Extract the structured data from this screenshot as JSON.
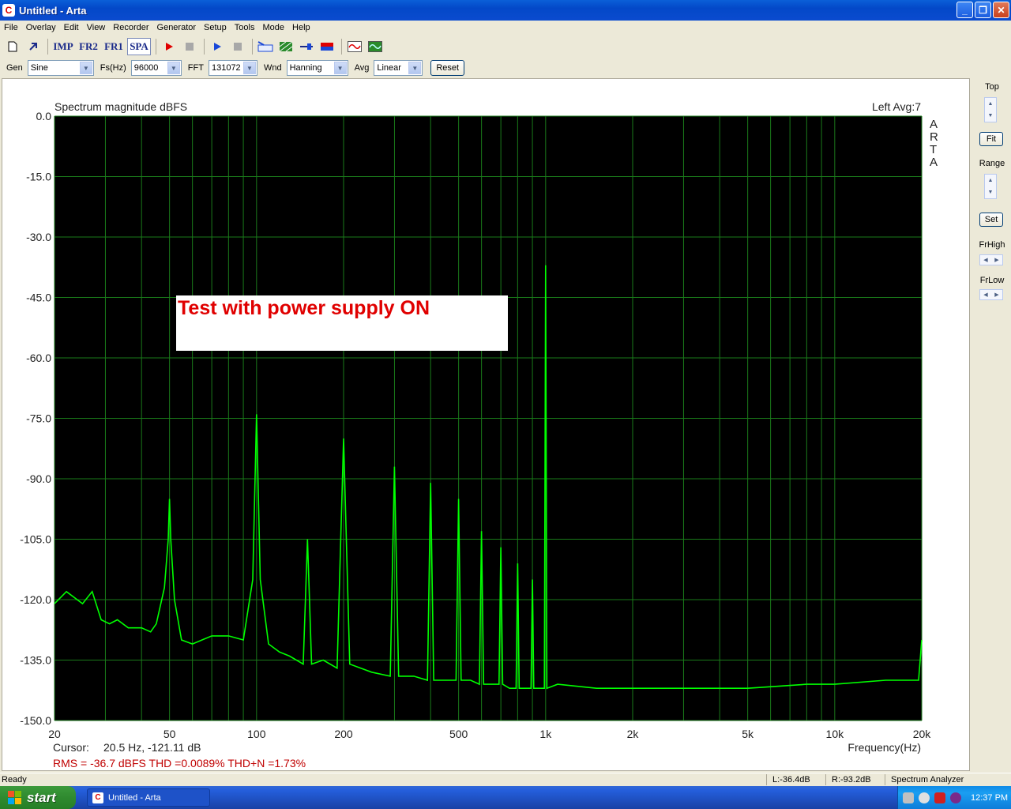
{
  "window": {
    "title": "Untitled - Arta",
    "app_icon_letter": "C",
    "min_glyph": "_",
    "max_glyph": "❐",
    "close_glyph": "✕"
  },
  "menu": [
    "File",
    "Overlay",
    "Edit",
    "View",
    "Recorder",
    "Generator",
    "Setup",
    "Tools",
    "Mode",
    "Help"
  ],
  "toolbar": {
    "imp_label": "IMP",
    "fr2_label": "FR2",
    "fr1_label": "FR1",
    "spa_label": "SPA"
  },
  "controls": {
    "gen_label": "Gen",
    "gen_value": "Sine",
    "fs_label": "Fs(Hz)",
    "fs_value": "96000",
    "fft_label": "FFT",
    "fft_value": "131072",
    "wnd_label": "Wnd",
    "wnd_value": "Hanning",
    "avg_label": "Avg",
    "avg_value": "Linear",
    "reset_label": "Reset"
  },
  "plot": {
    "annotation": "Test with power supply ON",
    "cursor_label": "Cursor:",
    "cursor_value": "20.5 Hz, -121.11 dB",
    "rms_line": "RMS =  -36.7 dBFS   THD =0.0089%   THD+N =1.73%",
    "channel_info": "Left  Avg:7",
    "watermark": [
      "A",
      "R",
      "T",
      "A"
    ],
    "colors": {
      "background": "#000000",
      "grid": "#1a7a1a",
      "trace": "#00ff00",
      "annotation": "#e00000",
      "stats": "#c00000"
    }
  },
  "chart_data": {
    "type": "line",
    "title": "Spectrum magnitude dBFS",
    "xlabel": "Frequency(Hz)",
    "ylabel": "",
    "x_scale": "log",
    "xlim": [
      20,
      20000
    ],
    "ylim": [
      -150,
      0
    ],
    "grid": true,
    "legend": "none",
    "y_ticks": [
      "0.0",
      "-15.0",
      "-30.0",
      "-45.0",
      "-60.0",
      "-75.0",
      "-90.0",
      "-105.0",
      "-120.0",
      "-135.0",
      "-150.0"
    ],
    "y_tick_values": [
      0,
      -15,
      -30,
      -45,
      -60,
      -75,
      -90,
      -105,
      -120,
      -135,
      -150
    ],
    "x_ticks": [
      "20",
      "50",
      "100",
      "200",
      "500",
      "1k",
      "2k",
      "5k",
      "10k",
      "20k"
    ],
    "x_tick_values": [
      20,
      50,
      100,
      200,
      500,
      1000,
      2000,
      5000,
      10000,
      20000
    ],
    "series": [
      {
        "x": [
          20,
          22,
          25,
          27,
          29,
          31,
          33,
          36,
          40,
          43,
          45,
          48,
          49.5,
          50,
          50.5,
          52,
          55,
          60,
          70,
          80,
          90,
          97,
          100,
          103,
          110,
          120,
          130,
          145,
          150,
          155,
          170,
          190,
          200,
          210,
          250,
          290,
          300,
          310,
          350,
          390,
          400,
          410,
          450,
          490,
          500,
          510,
          550,
          590,
          600,
          610,
          650,
          690,
          700,
          710,
          750,
          790,
          800,
          810,
          850,
          890,
          900,
          910,
          950,
          990,
          1000,
          1010,
          1100,
          1500,
          2000,
          3000,
          5000,
          8000,
          10000,
          15000,
          19500,
          20000
        ],
        "y": [
          -121,
          -118,
          -121,
          -118,
          -125,
          -126,
          -125,
          -127,
          -127,
          -128,
          -126,
          -117,
          -105,
          -95,
          -105,
          -120,
          -130,
          -131,
          -129,
          -129,
          -130,
          -115,
          -74,
          -115,
          -131,
          -133,
          -134,
          -136,
          -105,
          -136,
          -135,
          -137,
          -80,
          -136,
          -138,
          -139,
          -87,
          -139,
          -139,
          -140,
          -91,
          -140,
          -140,
          -140,
          -95,
          -140,
          -140,
          -141,
          -103,
          -141,
          -141,
          -141,
          -107,
          -141,
          -142,
          -142,
          -111,
          -142,
          -142,
          -142,
          -115,
          -142,
          -142,
          -142,
          -37,
          -142,
          -141,
          -142,
          -142,
          -142,
          -142,
          -141,
          -141,
          -140,
          -140,
          -130
        ]
      }
    ]
  },
  "right_panel": {
    "top_label": "Top",
    "fit_label": "Fit",
    "range_label": "Range",
    "set_label": "Set",
    "frhigh_label": "FrHigh",
    "frlow_label": "FrLow"
  },
  "status": {
    "ready": "Ready",
    "left_level": "L:-36.4dB",
    "right_level": "R:-93.2dB",
    "mode": "Spectrum Analyzer"
  },
  "taskbar": {
    "start_label": "start",
    "task_label": "Untitled - Arta",
    "clock": "12:37 PM"
  }
}
